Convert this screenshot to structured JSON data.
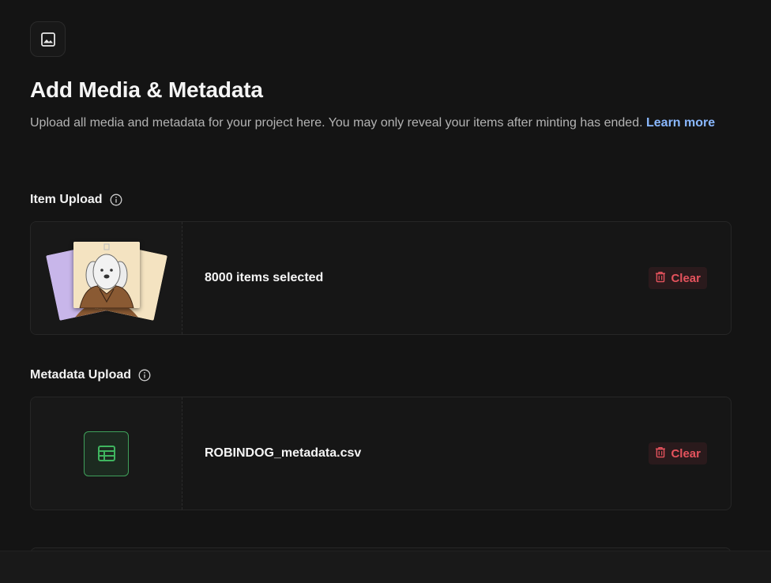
{
  "header": {
    "icon": "image-icon",
    "title": "Add Media & Metadata",
    "description": "Upload all media and metadata for your project here. You may only reveal your items after minting has ended.",
    "learn_more": "Learn more"
  },
  "item_upload": {
    "label": "Item Upload",
    "info_icon": "info-icon",
    "status": "8000 items selected",
    "clear_label": "Clear",
    "clear_icon": "trash-icon"
  },
  "metadata_upload": {
    "label": "Metadata Upload",
    "info_icon": "info-icon",
    "file_name": "ROBINDOG_metadata.csv",
    "file_icon": "table-icon",
    "clear_label": "Clear",
    "clear_icon": "trash-icon"
  },
  "colors": {
    "background": "#141414",
    "link": "#8ab8ff",
    "danger": "#e5535d",
    "csv_green": "#3fa05a"
  }
}
